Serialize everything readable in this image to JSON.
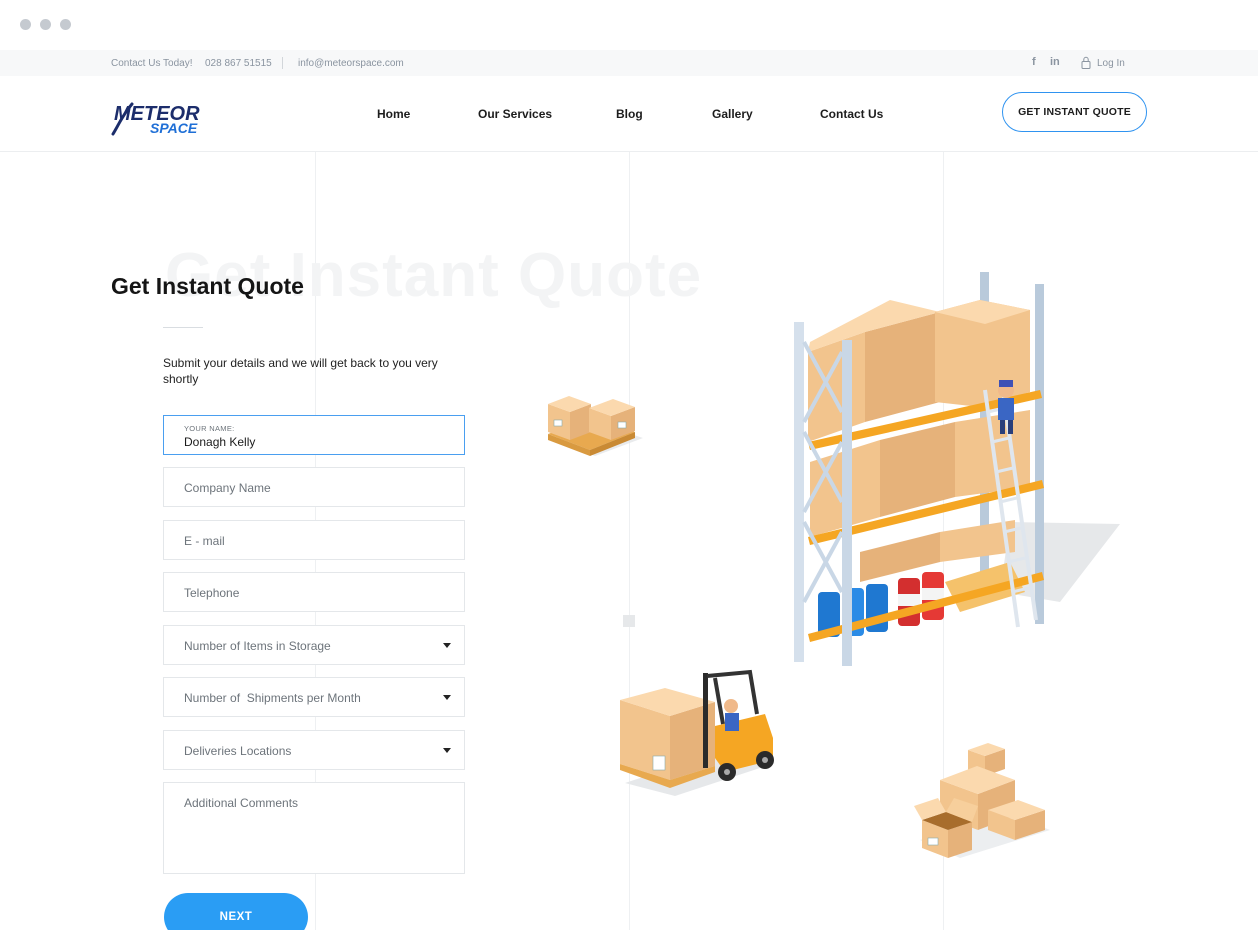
{
  "topbar": {
    "contact_label": "Contact Us Today!",
    "phone": "028 867 51515",
    "email": "info@meteorspace.com",
    "facebook_glyph": "f",
    "linkedin_glyph": "in",
    "login_label": "Log In"
  },
  "header": {
    "logo_line1": "METEOR",
    "logo_line2": "SPACE",
    "nav": [
      "Home",
      "Our Services",
      "Blog",
      "Gallery",
      "Contact Us"
    ],
    "cta_label": "GET INSTANT QUOTE"
  },
  "main": {
    "background_title": "Get Instant Quote",
    "title": "Get Instant Quote",
    "subtitle": "Submit your details and we will get back to you very shortly"
  },
  "form": {
    "name_label": "YOUR NAME:",
    "name_value": "Donagh Kelly",
    "company_placeholder": "Company Name",
    "email_placeholder": "E - mail",
    "telephone_placeholder": "Telephone",
    "items_placeholder": "Number of Items in Storage",
    "shipments_placeholder": "Number of  Shipments per Month",
    "locations_placeholder": "Deliveries Locations",
    "comments_placeholder": "Additional Comments",
    "next_label": "NEXT"
  },
  "colors": {
    "accent": "#2a9df4",
    "logo_dark": "#1c2d6b",
    "logo_blue": "#1f6fd6",
    "box": "#f5c993",
    "rack": "#c9d7e6",
    "shelf": "#f5a623",
    "forklift": "#f5a623"
  }
}
